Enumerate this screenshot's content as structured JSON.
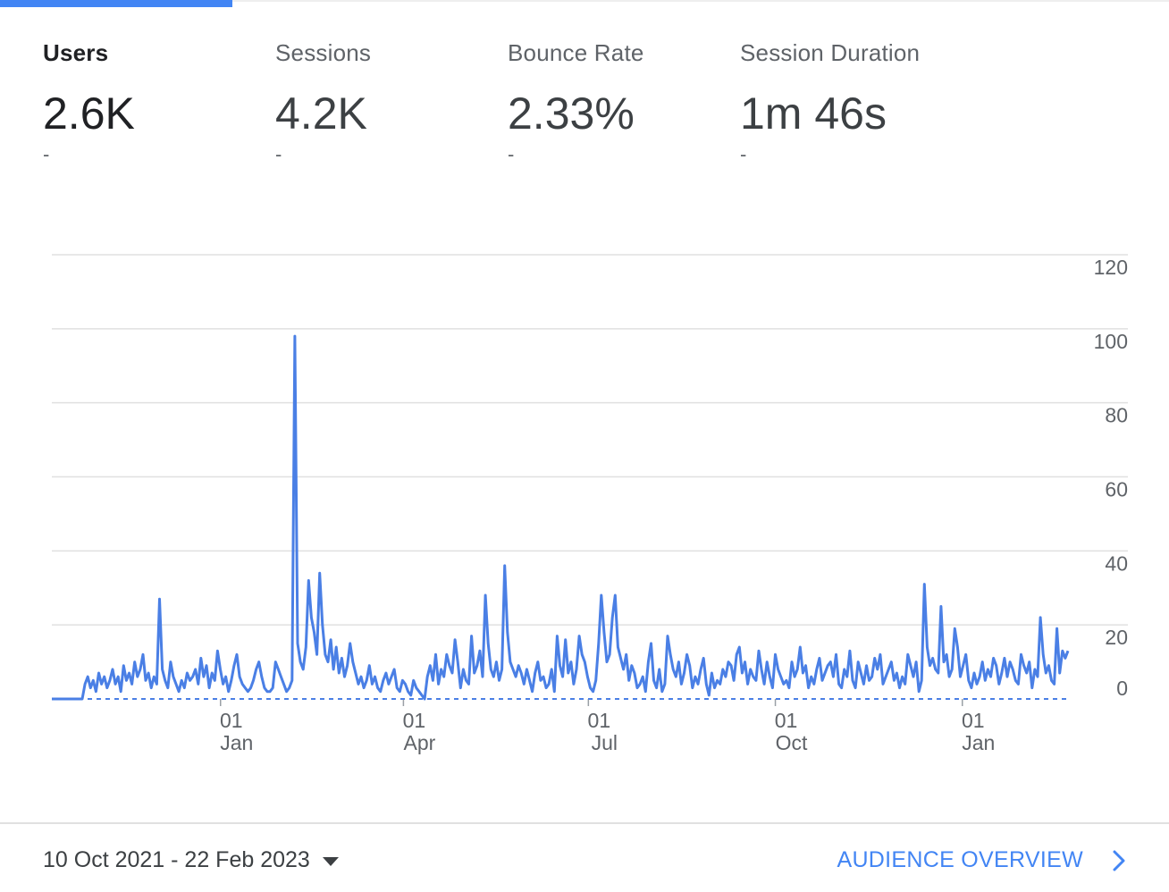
{
  "metrics": [
    {
      "label": "Users",
      "value": "2.6K",
      "delta": "-",
      "active": true
    },
    {
      "label": "Sessions",
      "value": "4.2K",
      "delta": "-",
      "active": false
    },
    {
      "label": "Bounce Rate",
      "value": "2.33%",
      "delta": "-",
      "active": false
    },
    {
      "label": "Session Duration",
      "value": "1m 46s",
      "delta": "-",
      "active": false
    }
  ],
  "footer": {
    "date_range": "10 Oct 2021 - 22 Feb 2023",
    "overview_link": "AUDIENCE OVERVIEW"
  },
  "colors": {
    "accent": "#4285f4",
    "line": "#4a7fe5",
    "grid": "#e0e0e0",
    "axis_text": "#5f6368"
  },
  "icons": {
    "date_dropdown": "caret-down-icon",
    "overview": "chevron-right-icon"
  },
  "chart_data": {
    "type": "line",
    "title": "",
    "xlabel": "",
    "ylabel": "",
    "ylim": [
      0,
      120
    ],
    "y_ticks": [
      0,
      20,
      40,
      60,
      80,
      100,
      120
    ],
    "x_ticks": [
      {
        "day": "01",
        "month": "Jan",
        "date": "2022-01-01"
      },
      {
        "day": "01",
        "month": "Apr",
        "date": "2022-04-01"
      },
      {
        "day": "01",
        "month": "Jul",
        "date": "2022-07-01"
      },
      {
        "day": "01",
        "month": "Oct",
        "date": "2022-10-01"
      },
      {
        "day": "01",
        "month": "Jan",
        "date": "2023-01-01"
      }
    ],
    "start_date": "2021-10-10",
    "end_date": "2023-02-22",
    "grid": true,
    "series": [
      {
        "values": [
          0,
          0,
          0,
          0,
          0,
          0,
          0,
          0,
          0,
          0,
          0,
          0,
          4,
          6,
          3,
          5,
          2,
          7,
          4,
          6,
          3,
          5,
          8,
          4,
          6,
          2,
          9,
          5,
          7,
          4,
          10,
          6,
          8,
          12,
          5,
          7,
          3,
          6,
          4,
          27,
          8,
          5,
          3,
          10,
          6,
          4,
          2,
          5,
          3,
          7,
          5,
          6,
          8,
          4,
          11,
          6,
          9,
          3,
          7,
          5,
          13,
          8,
          4,
          6,
          2,
          5,
          9,
          12,
          6,
          4,
          3,
          2,
          3,
          5,
          8,
          10,
          6,
          3,
          2,
          2,
          3,
          10,
          8,
          6,
          4,
          2,
          3,
          5,
          98,
          15,
          10,
          8,
          14,
          32,
          22,
          18,
          12,
          34,
          20,
          12,
          10,
          16,
          8,
          14,
          7,
          11,
          6,
          9,
          15,
          10,
          7,
          4,
          6,
          3,
          5,
          9,
          4,
          6,
          3,
          2,
          5,
          7,
          4,
          6,
          8,
          3,
          2,
          5,
          4,
          2,
          1,
          5,
          3,
          2,
          1,
          0,
          6,
          9,
          5,
          12,
          4,
          8,
          6,
          12,
          9,
          7,
          16,
          10,
          3,
          8,
          5,
          4,
          17,
          7,
          9,
          13,
          6,
          28,
          15,
          8,
          6,
          10,
          5,
          8,
          36,
          18,
          10,
          8,
          6,
          9,
          7,
          4,
          8,
          5,
          2,
          7,
          10,
          5,
          6,
          3,
          4,
          8,
          2,
          17,
          9,
          6,
          16,
          7,
          10,
          4,
          8,
          17,
          12,
          10,
          6,
          3,
          2,
          5,
          15,
          28,
          18,
          10,
          12,
          22,
          28,
          14,
          11,
          8,
          12,
          5,
          9,
          7,
          3,
          4,
          6,
          2,
          10,
          15,
          5,
          3,
          8,
          2,
          4,
          17,
          12,
          8,
          6,
          10,
          4,
          7,
          12,
          9,
          3,
          6,
          4,
          8,
          11,
          4,
          1,
          7,
          3,
          5,
          4,
          8,
          6,
          10,
          9,
          5,
          12,
          14,
          7,
          10,
          4,
          8,
          6,
          5,
          13,
          8,
          4,
          10,
          6,
          3,
          12,
          8,
          6,
          4,
          5,
          3,
          10,
          6,
          8,
          14,
          7,
          9,
          3,
          6,
          4,
          8,
          11,
          5,
          7,
          9,
          10,
          6,
          12,
          4,
          3,
          8,
          6,
          13,
          5,
          3,
          10,
          7,
          4,
          9,
          5,
          6,
          11,
          8,
          12,
          4,
          6,
          8,
          10,
          5,
          7,
          3,
          6,
          4,
          12,
          9,
          6,
          10,
          2,
          5,
          31,
          14,
          9,
          11,
          8,
          7,
          25,
          10,
          12,
          6,
          8,
          19,
          14,
          6,
          9,
          12,
          5,
          3,
          7,
          4,
          6,
          10,
          5,
          8,
          6,
          11,
          9,
          4,
          7,
          11,
          6,
          10,
          8,
          5,
          4,
          12,
          9,
          7,
          10,
          3,
          8,
          6,
          22,
          12,
          7,
          9,
          5,
          4,
          19,
          7,
          13,
          11,
          13
        ]
      }
    ]
  }
}
